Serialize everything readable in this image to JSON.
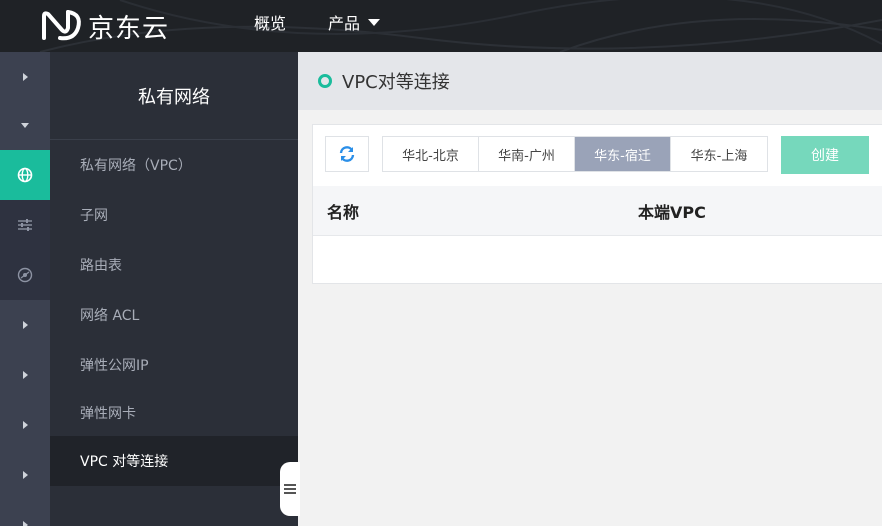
{
  "brand": {
    "logo_text": "京东云"
  },
  "topnav": {
    "items": [
      {
        "label": "概览"
      },
      {
        "label": "产品",
        "has_caret": true
      }
    ]
  },
  "rail": {
    "icons": [
      "chevron-right-icon",
      "chevron-down-icon",
      "globe-icon",
      "sliders-icon",
      "network-icon"
    ]
  },
  "sidebar": {
    "title": "私有网络",
    "items": [
      {
        "label": "私有网络（VPC）"
      },
      {
        "label": "子网"
      },
      {
        "label": "路由表"
      },
      {
        "label": "网络 ACL"
      },
      {
        "label": "弹性公网IP"
      },
      {
        "label": "弹性网卡"
      },
      {
        "label": "VPC 对等连接",
        "active": true
      }
    ]
  },
  "main": {
    "title": "VPC对等连接",
    "regions": [
      {
        "label": "华北-北京"
      },
      {
        "label": "华南-广州"
      },
      {
        "label": "华东-宿迁",
        "active": true
      },
      {
        "label": "华东-上海"
      }
    ],
    "create_label": "创建",
    "table": {
      "columns": [
        "名称",
        "本端VPC"
      ],
      "rows": []
    }
  },
  "colors": {
    "accent": "#1abc9c",
    "active_tab": "#9aa3b8",
    "create_button": "#76d8bc",
    "topbar": "#1f2226",
    "rail": "#3c4150",
    "sidebar": "#2b2f38"
  }
}
